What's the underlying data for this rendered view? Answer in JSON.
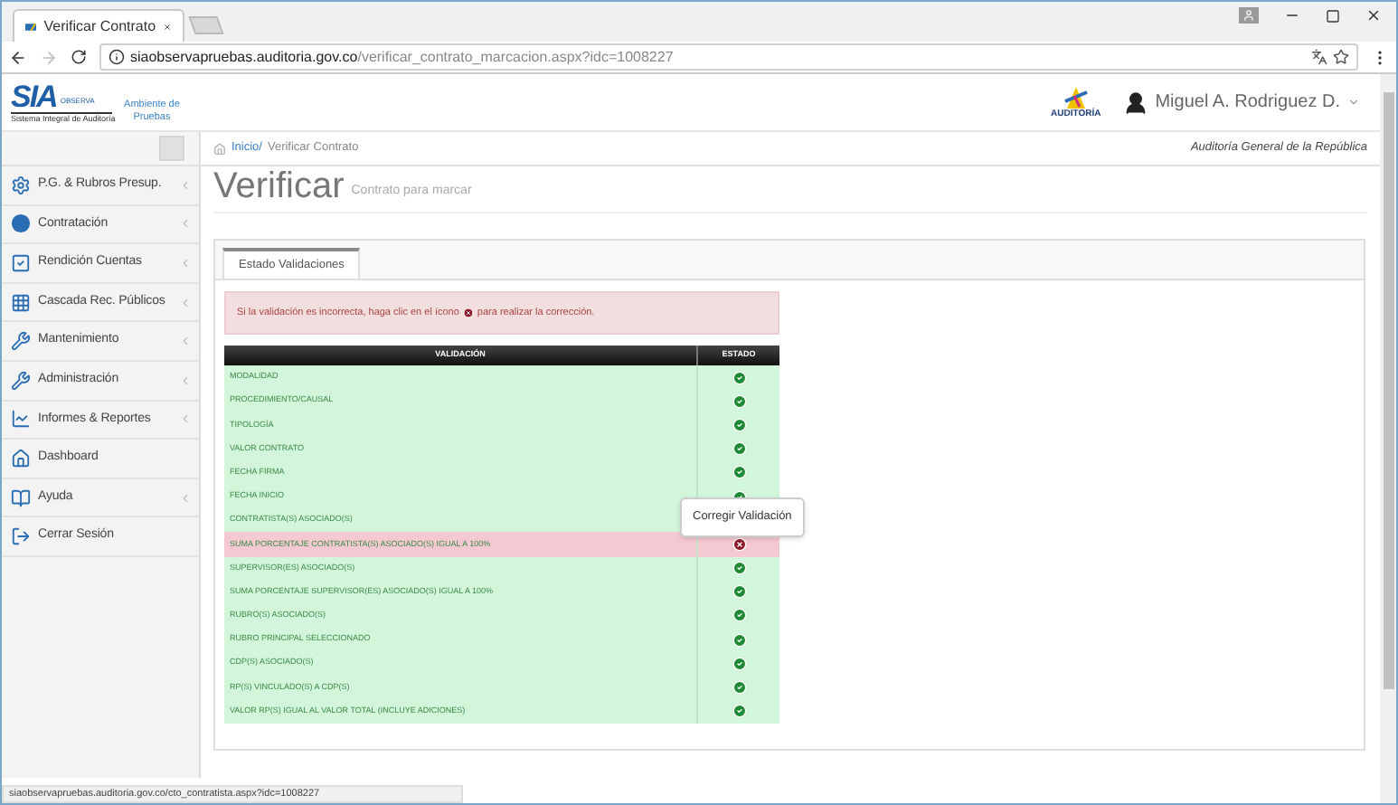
{
  "browser": {
    "tab_title": "Verificar Contrato",
    "url_host": "siaobservapruebas.auditoria.gov.co",
    "url_path": "/verificar_contrato_marcacion.aspx?idc=1008227",
    "status_url": "siaobservapruebas.auditoria.gov.co/cto_contratista.aspx?idc=1008227"
  },
  "header": {
    "logo_text": "SIA",
    "logo_tag": "OBSERVA",
    "logo_caption": "Sistema Integral de Auditoría",
    "environment": "Ambiente de Pruebas",
    "partner_logo_text": "AUDITORÍA",
    "user_name": "Miguel A. Rodriguez D."
  },
  "breadcrumb": {
    "items": [
      {
        "label": "Inicio/",
        "kind": "link"
      },
      {
        "label": "Verificar Contrato",
        "kind": "current"
      }
    ],
    "organization": "Auditoría General de la República"
  },
  "sidebar": {
    "items": [
      {
        "label": "P.G. & Rubros Presup.",
        "kind": "gears",
        "has_submenu": true
      },
      {
        "label": "Contratación",
        "kind": "dot",
        "has_submenu": true
      },
      {
        "label": "Rendición Cuentas",
        "kind": "check",
        "has_submenu": true
      },
      {
        "label": "Cascada Rec. Públicos",
        "kind": "grid",
        "has_submenu": true
      },
      {
        "label": "Mantenimiento",
        "kind": "wrench",
        "has_submenu": true
      },
      {
        "label": "Administración",
        "kind": "wrench",
        "has_submenu": true
      },
      {
        "label": "Informes & Reportes",
        "kind": "chart",
        "has_submenu": true
      },
      {
        "label": "Dashboard",
        "kind": "home",
        "has_submenu": false
      },
      {
        "label": "Ayuda",
        "kind": "book",
        "has_submenu": true
      },
      {
        "label": "Cerrar Sesión",
        "kind": "logout",
        "has_submenu": false
      }
    ]
  },
  "page": {
    "title": "Verificar",
    "subtitle": "Contrato para marcar"
  },
  "tabs": [
    {
      "label": "Estado Validaciones",
      "selected": true
    }
  ],
  "alert": {
    "before": "Si la validación es incorrecta, haga clic en el ícono",
    "after": "para realizar la corrección."
  },
  "table": {
    "columns": [
      "VALIDACIÓN",
      "ESTADO"
    ],
    "rows": [
      {
        "label": "MODALIDAD",
        "valid": true
      },
      {
        "label": "PROCEDIMIENTO/CAUSAL",
        "valid": true
      },
      {
        "label": "TIPOLOGÍA",
        "valid": true
      },
      {
        "label": "VALOR CONTRATO",
        "valid": true
      },
      {
        "label": "FECHA FIRMA",
        "valid": true
      },
      {
        "label": "FECHA INICIO",
        "valid": true
      },
      {
        "label": "CONTRATISTA(S) ASOCIADO(S)"
      },
      {
        "label": "SUMA PORCENTAJE CONTRATISTA(S) ASOCIADO(S) IGUAL A 100%",
        "valid": false
      },
      {
        "label": "SUPERVISOR(ES) ASOCIADO(S)",
        "valid": true
      },
      {
        "label": "SUMA PORCENTAJE SUPERVISOR(ES) ASOCIADO(S) IGUAL A 100%",
        "valid": true
      },
      {
        "label": "RUBRO(S) ASOCIADO(S)",
        "valid": true
      },
      {
        "label": "RUBRO PRINCIPAL SELECCIONADO",
        "valid": true
      },
      {
        "label": "CDP(S) ASOCIADO(S)",
        "valid": true
      },
      {
        "label": "RP(S) VINCULADO(S) A CDP(S)",
        "valid": true
      },
      {
        "label": "VALOR RP(S) IGUAL AL VALOR TOTAL (INCLUYE ADICIONES)",
        "valid": true
      }
    ]
  },
  "tooltip": {
    "text": "Corregir Validación"
  }
}
